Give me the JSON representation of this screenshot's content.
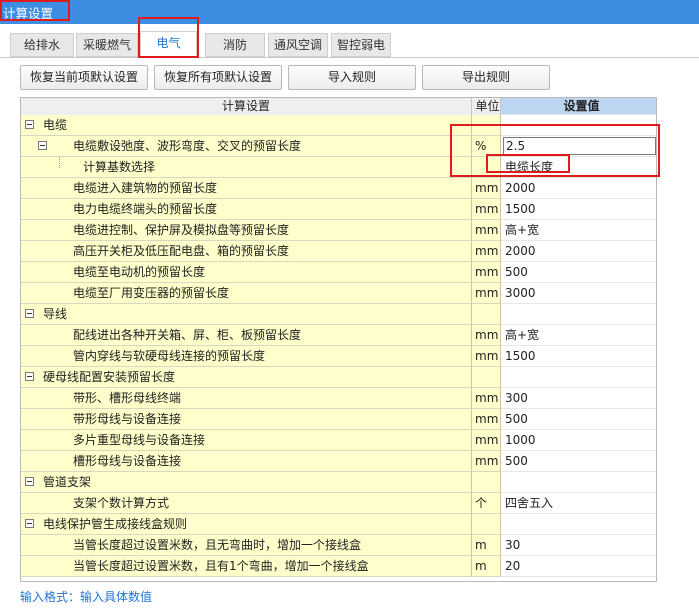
{
  "window": {
    "title": "计算设置"
  },
  "tabs": [
    {
      "label": "给排水",
      "left": 0
    },
    {
      "label": "采暖燃气"
    },
    {
      "label": "电气"
    },
    {
      "label": "消防"
    },
    {
      "label": "通风空调"
    },
    {
      "label": "智控弱电"
    }
  ],
  "toolbar": {
    "restore_current": "恢复当前项默认设置",
    "restore_all": "恢复所有项默认设置",
    "import": "导入规则",
    "export": "导出规则"
  },
  "grid": {
    "headers": {
      "setting": "计算设置",
      "unit": "单位",
      "value": "设置值"
    },
    "rows": [
      {
        "level": 0,
        "label": "电缆",
        "unit": "",
        "value": "",
        "group": true
      },
      {
        "level": 1,
        "label": "电缆敷设弛度、波形弯度、交叉的预留长度",
        "unit": "%",
        "value": "2.5",
        "group": true,
        "editing": true
      },
      {
        "level": 2,
        "label": "计算基数选择",
        "unit": "",
        "value": "电缆长度"
      },
      {
        "level": 1,
        "label": "电缆进入建筑物的预留长度",
        "unit": "mm",
        "value": "2000"
      },
      {
        "level": 1,
        "label": "电力电缆终端头的预留长度",
        "unit": "mm",
        "value": "1500"
      },
      {
        "level": 1,
        "label": "电缆进控制、保护屏及模拟盘等预留长度",
        "unit": "mm",
        "value": "高+宽"
      },
      {
        "level": 1,
        "label": "高压开关柜及低压配电盘、箱的预留长度",
        "unit": "mm",
        "value": "2000"
      },
      {
        "level": 1,
        "label": "电缆至电动机的预留长度",
        "unit": "mm",
        "value": "500"
      },
      {
        "level": 1,
        "label": "电缆至厂用变压器的预留长度",
        "unit": "mm",
        "value": "3000"
      },
      {
        "level": 0,
        "label": "导线",
        "unit": "",
        "value": "",
        "group": true
      },
      {
        "level": 1,
        "label": "配线进出各种开关箱、屏、柜、板预留长度",
        "unit": "mm",
        "value": "高+宽"
      },
      {
        "level": 1,
        "label": "管内穿线与软硬母线连接的预留长度",
        "unit": "mm",
        "value": "1500"
      },
      {
        "level": 0,
        "label": "硬母线配置安装预留长度",
        "unit": "",
        "value": "",
        "group": true
      },
      {
        "level": 1,
        "label": "带形、槽形母线终端",
        "unit": "mm",
        "value": "300"
      },
      {
        "level": 1,
        "label": "带形母线与设备连接",
        "unit": "mm",
        "value": "500"
      },
      {
        "level": 1,
        "label": "多片重型母线与设备连接",
        "unit": "mm",
        "value": "1000"
      },
      {
        "level": 1,
        "label": "槽形母线与设备连接",
        "unit": "mm",
        "value": "500"
      },
      {
        "level": 0,
        "label": "管道支架",
        "unit": "",
        "value": "",
        "group": true
      },
      {
        "level": 1,
        "label": "支架个数计算方式",
        "unit": "个",
        "value": "四舍五入"
      },
      {
        "level": 0,
        "label": "电线保护管生成接线盒规则",
        "unit": "",
        "value": "",
        "group": true
      },
      {
        "level": 1,
        "label": "当管长度超过设置米数，且无弯曲时，增加一个接线盒",
        "unit": "m",
        "value": "30"
      },
      {
        "level": 1,
        "label": "当管长度超过设置米数，且有1个弯曲，增加一个接线盒",
        "unit": "m",
        "value": "20"
      }
    ]
  },
  "status": {
    "hint": "输入格式：输入具体数值"
  }
}
